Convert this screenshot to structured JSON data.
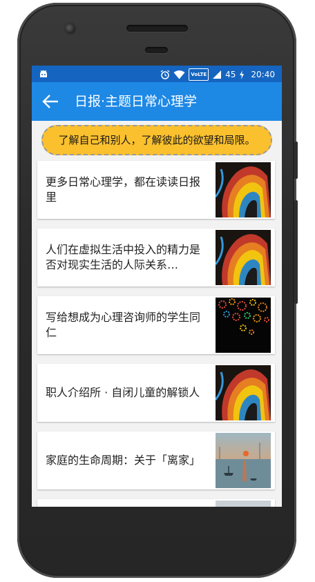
{
  "status_bar": {
    "time": "20:40",
    "battery": "45",
    "network_badge": "VoLTE",
    "icons": [
      "android-icon",
      "alarm-icon",
      "wifi-icon",
      "signal-icon",
      "battery-charging-icon"
    ]
  },
  "app_bar": {
    "title": "日报·主题日常心理学",
    "back_icon": "arrow-left-icon"
  },
  "banner": {
    "text": "了解自己和别人，了解彼此的欲望和局限。"
  },
  "stories": [
    {
      "title": "更多日常心理学，都在读读日报里",
      "thumb": "abstract-head-image"
    },
    {
      "title": "人们在虚拟生活中投入的精力是否对现实生活的人际关系…",
      "thumb": "abstract-head-image"
    },
    {
      "title": "写给想成为心理咨询师的学生同仁",
      "thumb": "gears-on-black-image"
    },
    {
      "title": "职人介绍所 · 自闭儿童的解锁人",
      "thumb": "abstract-head-image"
    },
    {
      "title": "家庭的生命周期：关于「离家」",
      "thumb": "impressionist-harbor-painting"
    }
  ],
  "colors": {
    "status_bar": "#1565c0",
    "app_bar": "#1e88e5",
    "banner": "#fbc02d"
  }
}
